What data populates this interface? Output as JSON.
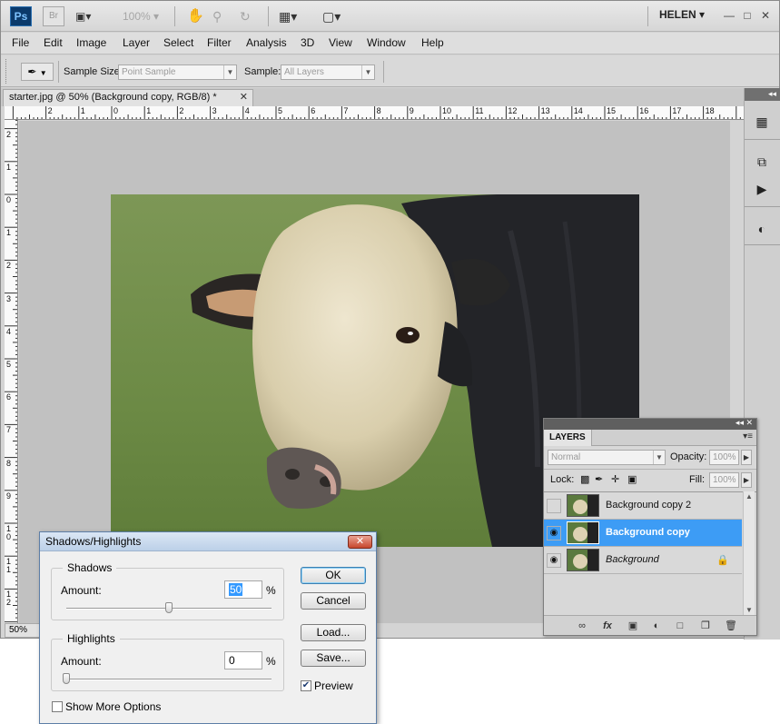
{
  "appbar": {
    "logo": "Ps",
    "bridge": "Br",
    "zoom": "100%",
    "user": "HELEN"
  },
  "menu": [
    "File",
    "Edit",
    "Image",
    "Layer",
    "Select",
    "Filter",
    "Analysis",
    "3D",
    "View",
    "Window",
    "Help"
  ],
  "options": {
    "sample_size_label": "Sample Size:",
    "sample_size_value": "Point Sample",
    "sample_label": "Sample:",
    "sample_value": "All Layers"
  },
  "document": {
    "tab_title": "starter.jpg @ 50% (Background copy, RGB/8) *",
    "status_zoom": "50%"
  },
  "rulers": {
    "top": [
      "2",
      "1",
      "0",
      "1",
      "2",
      "3",
      "4",
      "5",
      "6",
      "7",
      "8",
      "9",
      "10",
      "11",
      "12",
      "13",
      "14",
      "15",
      "16",
      "17",
      "18"
    ],
    "left": [
      "2",
      "1",
      "0",
      "1",
      "2",
      "3",
      "4",
      "5",
      "6",
      "7",
      "8",
      "9",
      "10",
      "11",
      "12"
    ]
  },
  "layers_panel": {
    "tab": "LAYERS",
    "blend_mode": "Normal",
    "opacity_label": "Opacity:",
    "opacity_value": "100%",
    "lock_label": "Lock:",
    "fill_label": "Fill:",
    "fill_value": "100%",
    "layers": [
      {
        "name": "Background copy 2",
        "visible": false,
        "selected": false,
        "locked": false
      },
      {
        "name": "Background copy",
        "visible": true,
        "selected": true,
        "locked": false
      },
      {
        "name": "Background",
        "visible": true,
        "selected": false,
        "locked": true
      }
    ],
    "selection_color": "#3d9cf5"
  },
  "dialog": {
    "title": "Shadows/Highlights",
    "shadows": {
      "title": "Shadows",
      "amount_label": "Amount:",
      "amount": "50",
      "unit": "%",
      "slider_percent": 50
    },
    "highlights": {
      "title": "Highlights",
      "amount_label": "Amount:",
      "amount": "0",
      "unit": "%",
      "slider_percent": 0
    },
    "buttons": {
      "ok": "OK",
      "cancel": "Cancel",
      "load": "Load...",
      "save": "Save..."
    },
    "preview_label": "Preview",
    "preview_checked": true,
    "more_options_label": "Show More Options",
    "more_options_checked": false
  }
}
